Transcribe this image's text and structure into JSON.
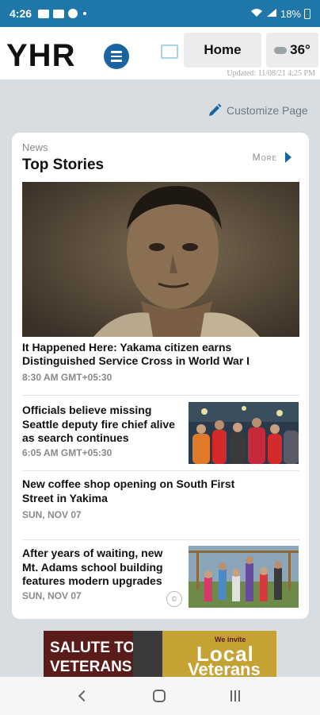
{
  "status": {
    "time": "4:26",
    "battery": "18%"
  },
  "header": {
    "logo": "YHR",
    "home_label": "Home",
    "temperature": "36°",
    "updated": "Updated: 11/08/21 4:25 PM"
  },
  "customize_label": "Customize Page",
  "section": {
    "kicker": "News",
    "title": "Top Stories",
    "more_label": "More"
  },
  "stories": [
    {
      "headline": "It Happened Here: Yakama citizen earns Distinguished Service Cross in World War I",
      "meta": "8:30 AM GMT+05:30"
    },
    {
      "headline": "Officials believe missing Seattle deputy fire chief alive as search continues",
      "meta": "6:05 AM GMT+05:30"
    },
    {
      "headline": "New coffee shop opening on South First Street in Yakima",
      "meta": "SUN, NOV 07"
    },
    {
      "headline": "After years of waiting, new Mt. Adams school building features modern upgrades",
      "meta": "SUN, NOV 07"
    }
  ],
  "ad": {
    "left_line1": "SALUTE TO",
    "left_line2": "VETERANS",
    "right_small": "We invite",
    "right_big1": "Local",
    "right_big2": "Veterans"
  },
  "colors": {
    "accent": "#1b64a2",
    "statusbar": "#1f76a8",
    "background": "#d7dde1"
  }
}
